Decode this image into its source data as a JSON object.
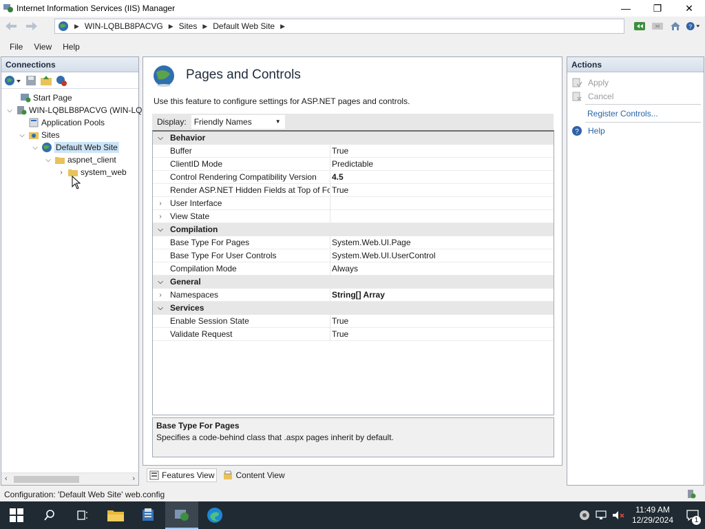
{
  "window": {
    "title": "Internet Information Services (IIS) Manager",
    "minimize": "—",
    "restore": "❐",
    "close": "✕"
  },
  "address": {
    "crumbs": [
      "WIN-LQBLB8PACVG",
      "Sites",
      "Default Web Site"
    ]
  },
  "menu": [
    "File",
    "View",
    "Help"
  ],
  "connections": {
    "title": "Connections",
    "tree": {
      "start_page": "Start Page",
      "server": "WIN-LQBLB8PACVG (WIN-LQ",
      "app_pools": "Application Pools",
      "sites": "Sites",
      "default_site": "Default Web Site",
      "aspnet_client": "aspnet_client",
      "system_web": "system_web"
    }
  },
  "main": {
    "title": "Pages and Controls",
    "description": "Use this feature to configure settings for ASP.NET pages and controls.",
    "display_label": "Display:",
    "display_value": "Friendly Names",
    "grid": [
      {
        "type": "cat",
        "name": "Behavior",
        "expanded": true
      },
      {
        "type": "prop",
        "name": "Buffer",
        "value": "True"
      },
      {
        "type": "prop",
        "name": "ClientID Mode",
        "value": "Predictable"
      },
      {
        "type": "prop",
        "name": "Control Rendering Compatibility Version",
        "value": "4.5",
        "bold": true
      },
      {
        "type": "prop",
        "name": "Render ASP.NET Hidden Fields at Top of For",
        "value": "True"
      },
      {
        "type": "sub",
        "name": "User Interface",
        "value": ""
      },
      {
        "type": "sub",
        "name": "View State",
        "value": ""
      },
      {
        "type": "cat",
        "name": "Compilation",
        "expanded": true
      },
      {
        "type": "prop",
        "name": "Base Type For Pages",
        "value": "System.Web.UI.Page"
      },
      {
        "type": "prop",
        "name": "Base Type For User Controls",
        "value": "System.Web.UI.UserControl"
      },
      {
        "type": "prop",
        "name": "Compilation Mode",
        "value": "Always"
      },
      {
        "type": "cat",
        "name": "General",
        "expanded": true
      },
      {
        "type": "sub",
        "name": "Namespaces",
        "value": "String[] Array",
        "bold": true
      },
      {
        "type": "cat",
        "name": "Services",
        "expanded": true
      },
      {
        "type": "prop",
        "name": "Enable Session State",
        "value": "True"
      },
      {
        "type": "prop",
        "name": "Validate Request",
        "value": "True"
      }
    ],
    "desc_title": "Base Type For Pages",
    "desc_text": "Specifies a code-behind class that .aspx pages inherit by default.",
    "tabs": {
      "features": "Features View",
      "content": "Content View"
    }
  },
  "actions": {
    "title": "Actions",
    "apply": "Apply",
    "cancel": "Cancel",
    "register": "Register Controls...",
    "help": "Help"
  },
  "status": {
    "text": "Configuration: 'Default Web Site' web.config"
  },
  "taskbar": {
    "time": "11:49 AM",
    "date": "12/29/2024",
    "notification_count": "1"
  }
}
